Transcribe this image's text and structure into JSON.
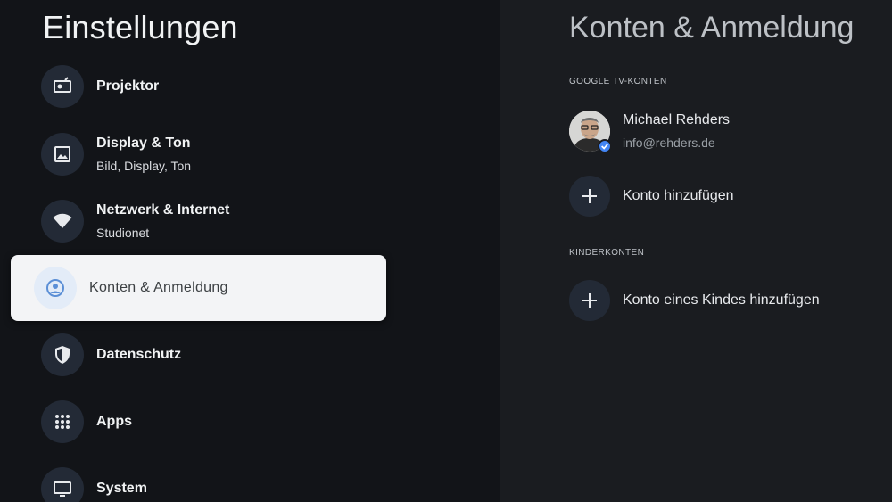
{
  "left": {
    "title": "Einstellungen",
    "items": [
      {
        "label": "Projektor",
        "icon": "projector-icon"
      },
      {
        "label": "Display & Ton",
        "sub": "Bild, Display, Ton",
        "icon": "image-icon"
      },
      {
        "label": "Netzwerk & Internet",
        "sub": "Studionet",
        "icon": "wifi-icon"
      },
      {
        "label": "Konten & Anmeldung",
        "icon": "account-icon"
      },
      {
        "label": "Datenschutz",
        "icon": "shield-icon"
      },
      {
        "label": "Apps",
        "icon": "apps-grid-icon"
      },
      {
        "label": "System",
        "icon": "monitor-icon"
      }
    ]
  },
  "right": {
    "title": "Konten & Anmeldung",
    "google_section": "GOOGLE TV-KONTEN",
    "account": {
      "name": "Michael Rehders",
      "email": "info@rehders.de"
    },
    "add_account": "Konto hinzufügen",
    "kids_section": "KINDERKONTEN",
    "add_kid_account": "Konto eines Kindes hinzufügen"
  },
  "colors": {
    "background": "#121418",
    "panel": "#1a1c20",
    "icon_bg": "#232a36",
    "selected_bg": "#f3f4f6",
    "accent": "#4285f4"
  }
}
